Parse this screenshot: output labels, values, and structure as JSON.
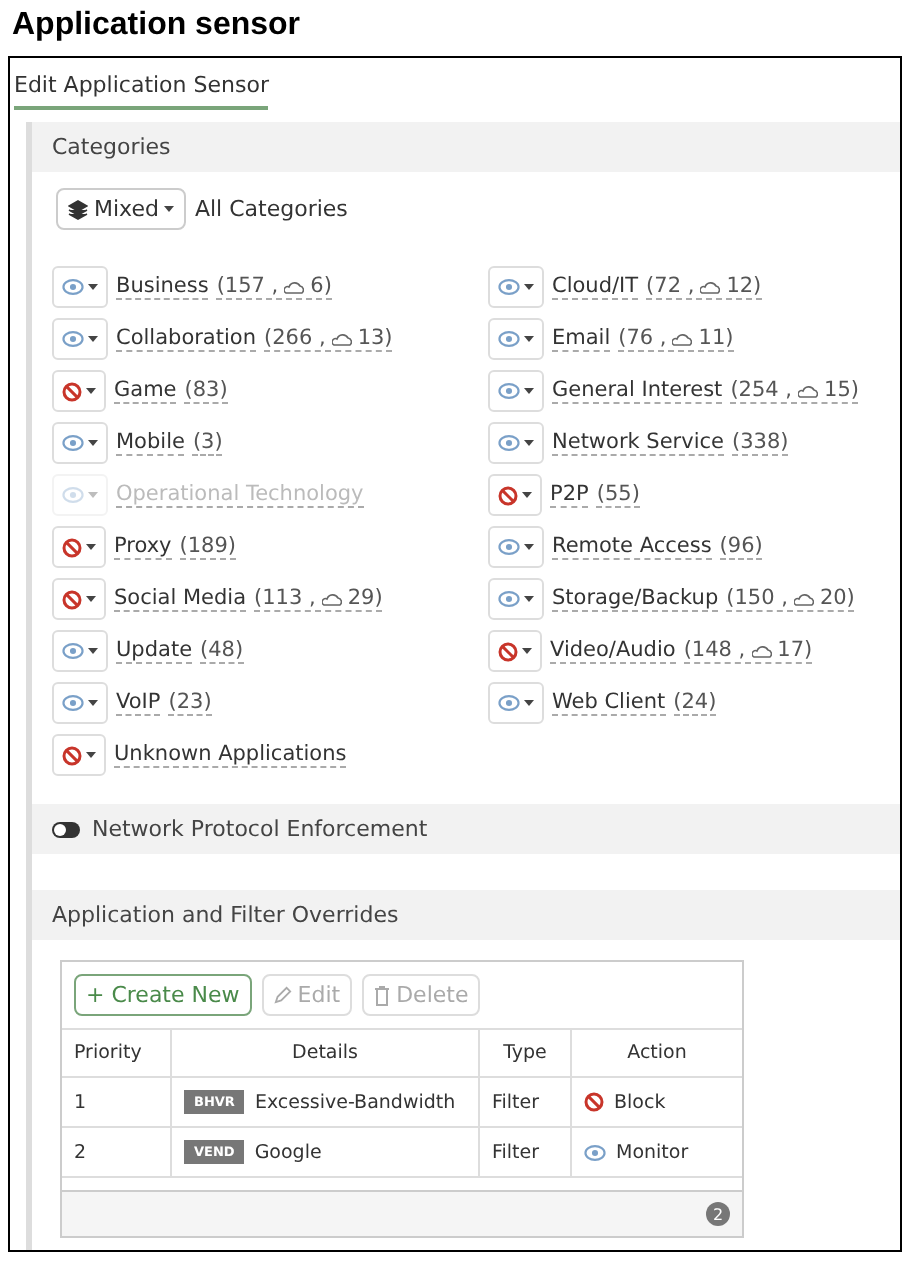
{
  "page_title": "Application sensor",
  "tab": {
    "label": "Edit Application Sensor",
    "selected": true
  },
  "categories": {
    "header": "Categories",
    "mixed_button": "Mixed",
    "all_label": "All Categories",
    "left": [
      {
        "name": "Business",
        "count": "(157 ,",
        "cloud": "6)",
        "kind": "monitor",
        "disabled": false
      },
      {
        "name": "Collaboration",
        "count": "(266 ,",
        "cloud": "13)",
        "kind": "monitor",
        "disabled": false
      },
      {
        "name": "Game",
        "count": "(83)",
        "kind": "block",
        "disabled": false
      },
      {
        "name": "Mobile",
        "count": "(3)",
        "kind": "monitor",
        "disabled": false
      },
      {
        "name": "Operational Technology",
        "kind": "monitor",
        "disabled": true
      },
      {
        "name": "Proxy",
        "count": "(189)",
        "kind": "block",
        "disabled": false
      },
      {
        "name": "Social Media",
        "count": "(113 ,",
        "cloud": "29)",
        "kind": "block",
        "disabled": false
      },
      {
        "name": "Update",
        "count": "(48)",
        "kind": "monitor",
        "disabled": false
      },
      {
        "name": "VoIP",
        "count": "(23)",
        "kind": "monitor",
        "disabled": false
      },
      {
        "name": "Unknown Applications",
        "kind": "block",
        "disabled": false
      }
    ],
    "right": [
      {
        "name": "Cloud/IT",
        "count": "(72 ,",
        "cloud": "12)",
        "kind": "monitor",
        "disabled": false
      },
      {
        "name": "Email",
        "count": "(76 ,",
        "cloud": "11)",
        "kind": "monitor",
        "disabled": false
      },
      {
        "name": "General Interest",
        "count": "(254 ,",
        "cloud": "15)",
        "kind": "monitor",
        "disabled": false
      },
      {
        "name": "Network Service",
        "count": "(338)",
        "kind": "monitor",
        "disabled": false
      },
      {
        "name": "P2P",
        "count": "(55)",
        "kind": "block",
        "disabled": false
      },
      {
        "name": "Remote Access",
        "count": "(96)",
        "kind": "monitor",
        "disabled": false
      },
      {
        "name": "Storage/Backup",
        "count": "(150 ,",
        "cloud": "20)",
        "kind": "monitor",
        "disabled": false
      },
      {
        "name": "Video/Audio",
        "count": "(148 ,",
        "cloud": "17)",
        "kind": "block",
        "disabled": false
      },
      {
        "name": "Web Client",
        "count": "(24)",
        "kind": "monitor",
        "disabled": false
      }
    ]
  },
  "protocol_enforcement": {
    "label": "Network Protocol Enforcement",
    "on": false
  },
  "overrides": {
    "header": "Application and Filter Overrides",
    "toolbar": [
      {
        "label": "+ Create New",
        "kind": "create",
        "disabled": false
      },
      {
        "label": "Edit",
        "kind": "edit",
        "disabled": true
      },
      {
        "label": "Delete",
        "kind": "delete",
        "disabled": true
      }
    ],
    "columns": [
      "Priority",
      "Details",
      "Type",
      "Action"
    ],
    "rows": [
      {
        "priority": "1",
        "tag": "BHVR",
        "details": "Excessive-Bandwidth",
        "type": "Filter",
        "action": "Block",
        "kind": "block"
      },
      {
        "priority": "2",
        "tag": "VEND",
        "details": "Google",
        "type": "Filter",
        "action": "Monitor",
        "kind": "monitor"
      }
    ],
    "count": "2"
  }
}
